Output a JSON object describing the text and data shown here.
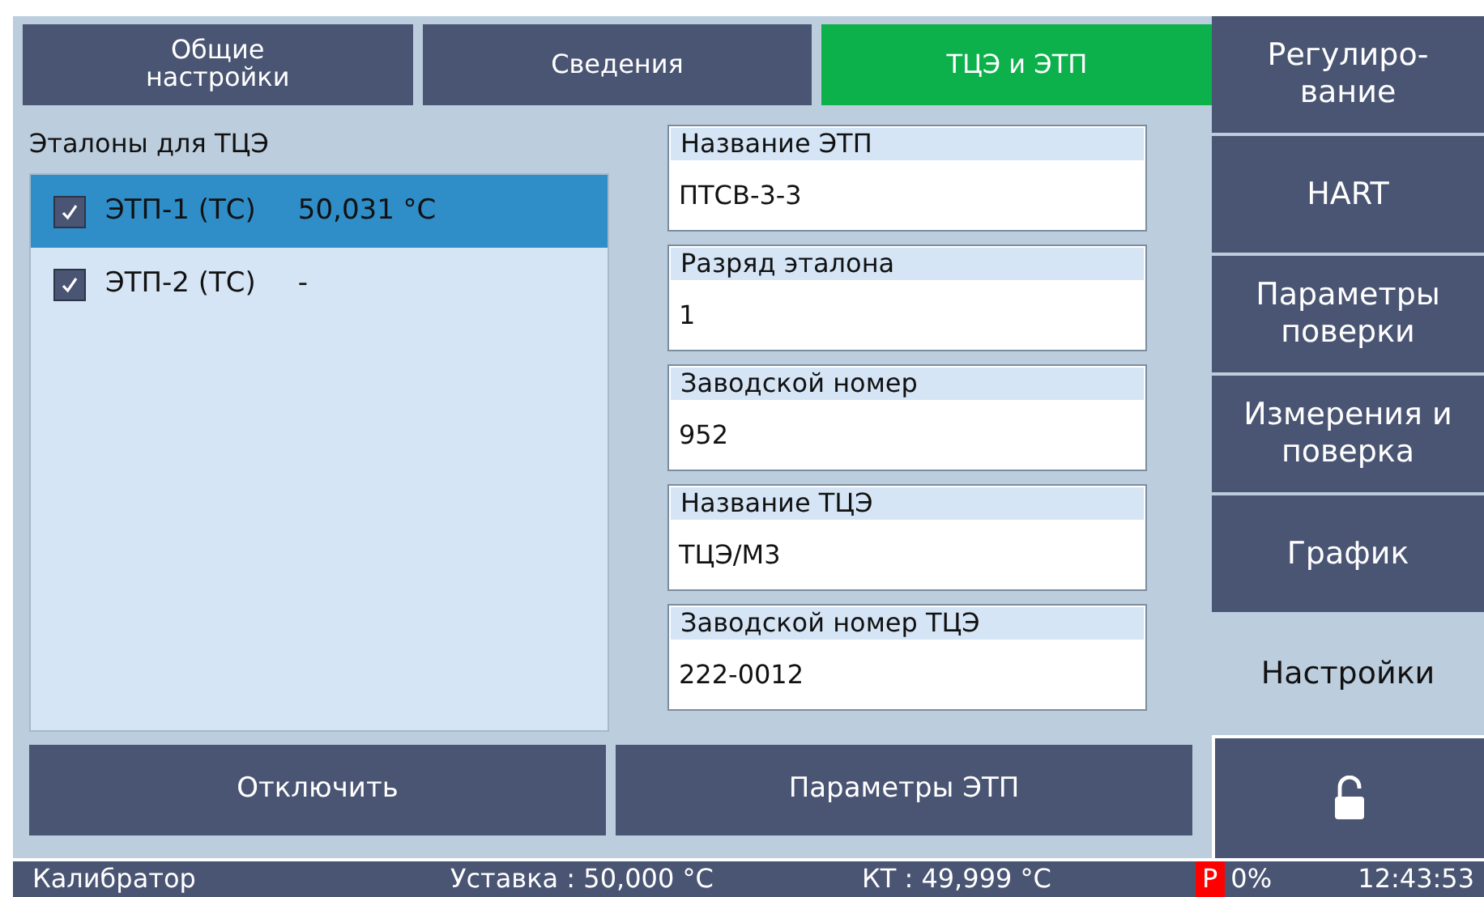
{
  "tabs": [
    {
      "label": "Общие\nнастройки",
      "selected": false
    },
    {
      "label": "Сведения",
      "selected": false
    },
    {
      "label": "ТЦЭ и ЭТП",
      "selected": true
    }
  ],
  "standards": {
    "title": "Эталоны для ТЦЭ",
    "items": [
      {
        "label": "ЭТП-1 (ТС)",
        "value": "50,031 °C",
        "checked": true,
        "selected": true
      },
      {
        "label": "ЭТП-2 (ТС)",
        "value": "-",
        "checked": true,
        "selected": false
      }
    ]
  },
  "fields": [
    {
      "label": "Название ЭТП",
      "value": "ПТСВ-3-3"
    },
    {
      "label": "Разряд эталона",
      "value": "1"
    },
    {
      "label": "Заводской номер",
      "value": "952"
    },
    {
      "label": "Название ТЦЭ",
      "value": "ТЦЭ/М3"
    },
    {
      "label": "Заводской номер ТЦЭ",
      "value": "222-0012"
    }
  ],
  "buttons": [
    "Отключить",
    "Параметры ЭТП"
  ],
  "sidebar": {
    "items": [
      {
        "kind": "text",
        "label": "Регулиро-\nвание",
        "selected": false
      },
      {
        "kind": "text",
        "label": "HART",
        "selected": false
      },
      {
        "kind": "text",
        "label": "Параметры\nповерки",
        "selected": false
      },
      {
        "kind": "text",
        "label": "Измерения и\nповерка",
        "selected": false
      },
      {
        "kind": "text",
        "label": "График",
        "selected": false
      },
      {
        "kind": "text",
        "label": "Настройки",
        "selected": true
      },
      {
        "kind": "lock",
        "selected": false
      }
    ]
  },
  "status_bar": {
    "device": "Калибратор",
    "setpoint": "Уставка : 50,000 °C",
    "reading": "КТ : 49,999 °C",
    "mode": "Р",
    "percent": "0%",
    "time": "12:43:53"
  }
}
